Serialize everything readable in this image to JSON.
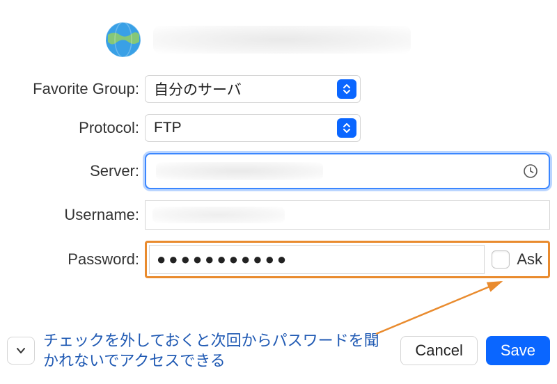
{
  "header": {
    "icon": "globe-icon"
  },
  "fields": {
    "favorite_group": {
      "label": "Favorite Group:",
      "value": "自分のサーバ"
    },
    "protocol": {
      "label": "Protocol:",
      "value": "FTP"
    },
    "server": {
      "label": "Server:",
      "value": ""
    },
    "username": {
      "label": "Username:",
      "value": ""
    },
    "password": {
      "label": "Password:",
      "value_masked": "●●●●●●●●●●●",
      "ask_label": "Ask",
      "ask_checked": false
    }
  },
  "buttons": {
    "cancel": "Cancel",
    "save": "Save"
  },
  "annotation": {
    "text": "チェックを外しておくと次回からパスワードを聞かれないでアクセスできる",
    "color": "#1f59b3",
    "highlight_color": "#e98b2e"
  }
}
